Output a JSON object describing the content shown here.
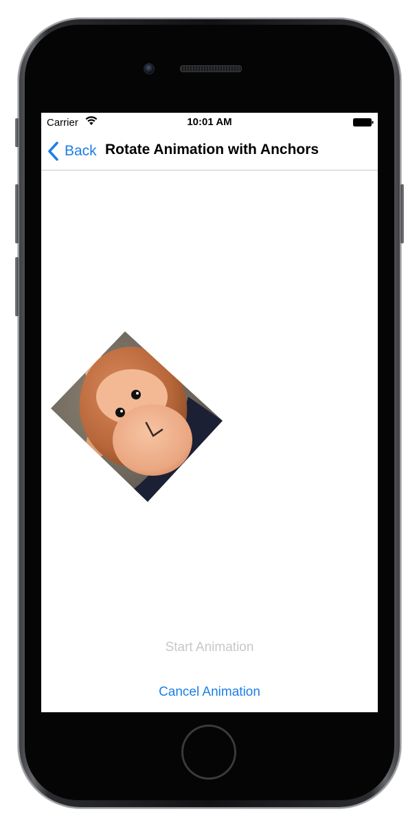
{
  "status_bar": {
    "carrier": "Carrier",
    "time": "10:01 AM",
    "wifi_icon": "wifi-icon",
    "battery_icon": "battery-full-icon"
  },
  "nav": {
    "back_label": "Back",
    "back_icon": "chevron-left-icon",
    "title": "Rotate Animation with Anchors"
  },
  "content": {
    "image_subject": "plush monkey toy photo",
    "start_label": "Start Animation",
    "start_enabled": false,
    "cancel_label": "Cancel Animation",
    "cancel_enabled": true
  },
  "colors": {
    "tint": "#1a7fe6",
    "disabled": "#c7c7cc",
    "separator": "#c8c8cc",
    "device_body": "#121214"
  }
}
